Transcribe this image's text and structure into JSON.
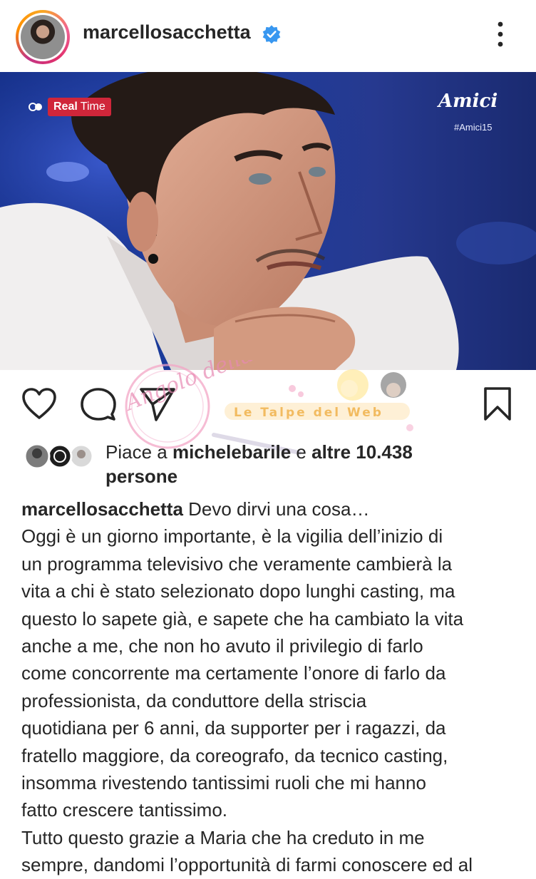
{
  "post_header": {
    "username": "marcellosacchetta",
    "verified_icon": "verified-badge-icon",
    "more_icon": "more-options-icon",
    "verified_color": "#3897f0"
  },
  "photo": {
    "channel_badge_part1": "Real",
    "channel_badge_part2": "Time",
    "show_logo": "Amici",
    "show_hashtag": "#Amici15",
    "badge_color": "#d0263a"
  },
  "action_bar": {
    "like_icon": "heart-icon",
    "comment_icon": "comment-icon",
    "share_icon": "share-icon",
    "save_icon": "bookmark-icon"
  },
  "watermark": {
    "text1": "Angolo della News",
    "text2": "Le Talpe del Web"
  },
  "likes": {
    "prefix": "Piace a",
    "user": "michelebarile",
    "joiner": "e",
    "others": "altre 10.438",
    "suffix": "persone"
  },
  "caption": {
    "author": "marcellosacchetta",
    "first_line_rest": " Devo dirvi una cosa…",
    "lines": [
      "Oggi è un giorno importante, è la vigilia dell’inizio di",
      "un programma televisivo che veramente cambierà la",
      "vita a chi è stato selezionato dopo lunghi casting, ma",
      "questo lo sapete già, e sapete che ha cambiato la vita",
      "anche a me, che non ho avuto il privilegio di farlo",
      "come concorrente ma certamente l’onore di farlo da",
      "professionista, da conduttore della striscia",
      "quotidiana per 6 anni, da supporter per i ragazzi, da",
      "fratello maggiore, da coreografo, da tecnico casting,",
      "insomma rivestendo tantissimi ruoli che mi hanno",
      "fatto crescere tantissimo.",
      "Tutto questo grazie a Maria che ha creduto in me",
      "sempre, dandomi l’opportunità di farmi conoscere ed al"
    ]
  }
}
